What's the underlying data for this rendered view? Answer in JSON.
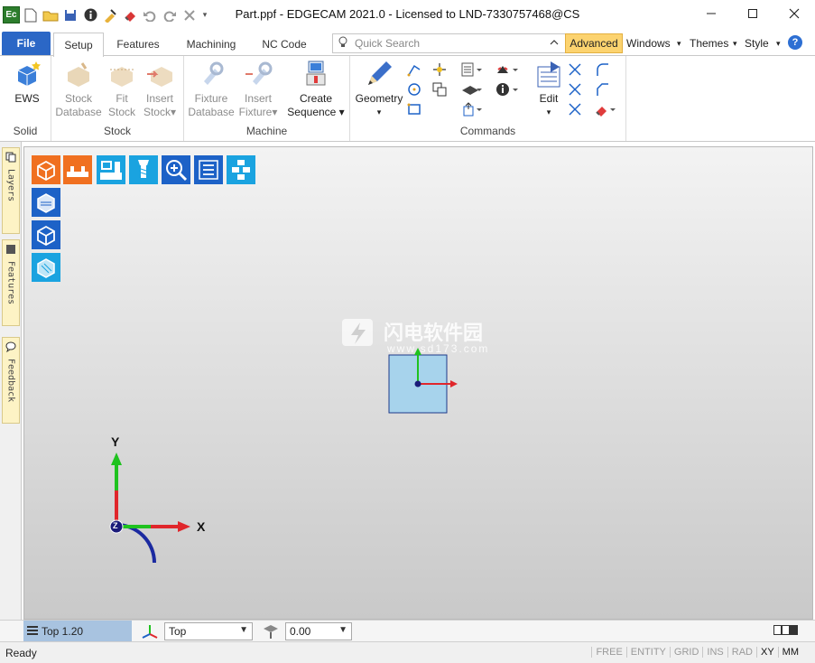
{
  "window": {
    "title": "Part.ppf - EDGECAM 2021.0  -  Licensed to LND-7330757468@CS",
    "app_logo": "Ec",
    "controls": [
      "minimize-icon",
      "maximize-icon",
      "close-icon"
    ]
  },
  "quick_access": [
    "new-icon",
    "open-icon",
    "save-icon",
    "info-icon",
    "clean-icon",
    "erase-icon",
    "undo-icon",
    "redo-icon",
    "cancel-icon",
    "customize-icon"
  ],
  "ribbon": {
    "file_label": "File",
    "tabs": [
      "Setup",
      "Features",
      "Machining",
      "NC Code"
    ],
    "active_tab": "Setup",
    "search_placeholder": "Quick Search",
    "advanced_label": "Advanced",
    "right_menus": [
      "Windows",
      "Themes",
      "Style"
    ],
    "groups": {
      "solid": {
        "label": "Solid",
        "buttons": [
          {
            "label": "EWS",
            "enabled": true
          }
        ]
      },
      "stock": {
        "label": "Stock",
        "buttons": [
          {
            "line1": "Stock",
            "line2": "Database",
            "enabled": false
          },
          {
            "line1": "Fit",
            "line2": "Stock",
            "enabled": false
          },
          {
            "line1": "Insert",
            "line2": "Stock",
            "enabled": false
          }
        ]
      },
      "machine": {
        "label": "Machine",
        "buttons": [
          {
            "line1": "Fixture",
            "line2": "Database",
            "enabled": false
          },
          {
            "line1": "Insert",
            "line2": "Fixture",
            "enabled": false
          },
          {
            "line1": "Create",
            "line2": "Sequence",
            "enabled": true
          }
        ]
      },
      "commands": {
        "label": "Commands",
        "buttons": [
          {
            "label": "Geometry"
          },
          {
            "label": "Edit"
          }
        ]
      }
    }
  },
  "side_panel": {
    "tabs": [
      "Layers",
      "Features",
      "Feedback"
    ]
  },
  "viewport": {
    "toolbar_icons": [
      "stock-icon",
      "fixture-icon",
      "machine-tool-icon",
      "tool-icon",
      "zoom-icon",
      "list-icon",
      "cpl-icon",
      "feature-box-icon",
      "cube-icon",
      "solid-cube-icon"
    ],
    "watermark": "闪电软件园",
    "watermark_sub": "www.sd173.com",
    "axis_x": "X",
    "axis_y": "Y",
    "axis_z": "Z",
    "colors": {
      "x_axis": "#e0262b",
      "y_axis": "#1fc21f",
      "z_axis": "#1b1b7a",
      "part": "#a7d3ec"
    }
  },
  "view_bar": {
    "view_name": "Top 1.20",
    "cpl_value": "Top",
    "z_value": "0.00"
  },
  "status_bar": {
    "ready": "Ready",
    "modes": [
      {
        "label": "FREE",
        "active": false
      },
      {
        "label": "ENTITY",
        "active": false
      },
      {
        "label": "GRID",
        "active": false
      },
      {
        "label": "INS",
        "active": false
      },
      {
        "label": "RAD",
        "active": false
      },
      {
        "label": "XY",
        "active": true
      },
      {
        "label": "MM",
        "active": true
      }
    ]
  }
}
